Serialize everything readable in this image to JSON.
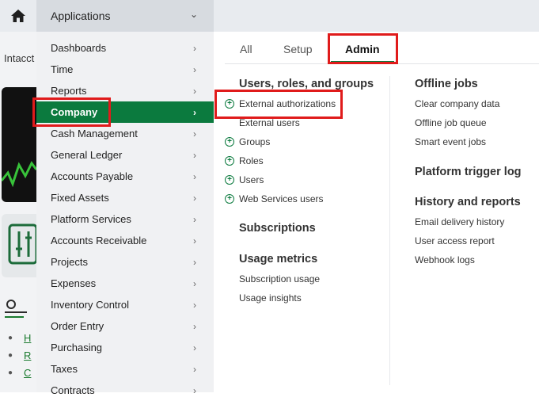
{
  "topbar": {
    "apps_label": "Applications"
  },
  "background": {
    "partial_text": "Intacct",
    "links": [
      "H",
      "R",
      "C"
    ]
  },
  "menu": {
    "items": [
      {
        "label": "Dashboards"
      },
      {
        "label": "Time"
      },
      {
        "label": "Reports"
      },
      {
        "label": "Company",
        "active": true
      },
      {
        "label": "Cash Management"
      },
      {
        "label": "General Ledger"
      },
      {
        "label": "Accounts Payable"
      },
      {
        "label": "Fixed Assets"
      },
      {
        "label": "Platform Services"
      },
      {
        "label": "Accounts Receivable"
      },
      {
        "label": "Projects"
      },
      {
        "label": "Expenses"
      },
      {
        "label": "Inventory Control"
      },
      {
        "label": "Order Entry"
      },
      {
        "label": "Purchasing"
      },
      {
        "label": "Taxes"
      },
      {
        "label": "Contracts"
      }
    ]
  },
  "tabs": [
    "All",
    "Setup",
    "Admin"
  ],
  "active_tab": "Admin",
  "col1": {
    "users_header": "Users, roles, and groups",
    "users_links": [
      {
        "label": "External authorizations",
        "plus": true
      },
      {
        "label": "External users",
        "plus": false
      },
      {
        "label": "Groups",
        "plus": true
      },
      {
        "label": "Roles",
        "plus": true
      },
      {
        "label": "Users",
        "plus": true
      },
      {
        "label": "Web Services users",
        "plus": true
      }
    ],
    "subs_header": "Subscriptions",
    "usage_header": "Usage metrics",
    "usage_links": [
      "Subscription usage",
      "Usage insights"
    ]
  },
  "col2": {
    "offline_header": "Offline jobs",
    "offline_links": [
      "Clear company data",
      "Offline job queue",
      "Smart event jobs"
    ],
    "trigger_header": "Platform trigger log",
    "history_header": "History and reports",
    "history_links": [
      "Email delivery history",
      "User access report",
      "Webhook logs"
    ]
  },
  "colors": {
    "accent": "#0b7a3e",
    "highlight": "#e01b1b"
  }
}
